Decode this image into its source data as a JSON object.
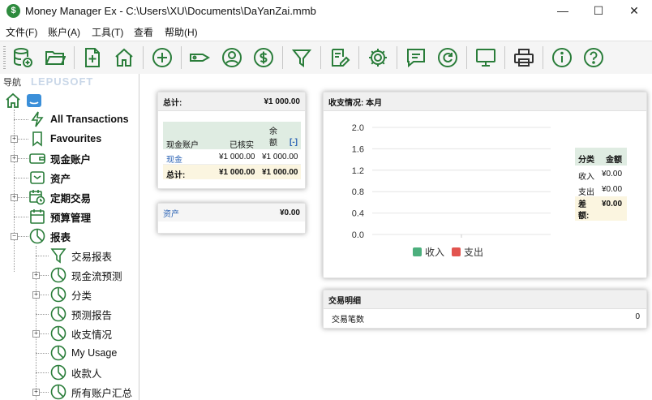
{
  "window": {
    "title": "Money Manager Ex - C:\\Users\\XU\\Documents\\DaYanZai.mmb",
    "app_icon_glyph": "$",
    "min_glyph": "—",
    "max_glyph": "☐",
    "close_glyph": "✕"
  },
  "menu": [
    "文件(F)",
    "账户(A)",
    "工具(T)",
    "查看",
    "帮助(H)"
  ],
  "toolbar": {
    "buttons": [
      "database-icon",
      "open-folder-icon",
      "new-file-icon",
      "home-icon",
      "add-transaction-icon",
      "tag-icon",
      "user-icon",
      "currency-icon",
      "filter-icon",
      "edit-icon",
      "settings-icon",
      "chat-icon",
      "refresh-icon",
      "monitor-icon",
      "print-icon",
      "info-icon",
      "help-icon"
    ],
    "accent_color": "#2a7d3a"
  },
  "nav": {
    "title": "导航",
    "watermark": "LEPUSOFT",
    "items": [
      {
        "label": "All Transactions",
        "bold": true
      },
      {
        "label": "Favourites",
        "bold": true
      },
      {
        "label": "现金账户",
        "bold": true
      },
      {
        "label": "资产",
        "bold": true
      },
      {
        "label": "定期交易",
        "bold": true
      },
      {
        "label": "预算管理",
        "bold": true
      },
      {
        "label": "报表",
        "bold": true
      },
      {
        "label": "交易报表",
        "bold": false
      },
      {
        "label": "现金流预测",
        "bold": false
      },
      {
        "label": "分类",
        "bold": false
      },
      {
        "label": "预测报告",
        "bold": false
      },
      {
        "label": "收支情况",
        "bold": false
      },
      {
        "label": "My Usage",
        "bold": false
      },
      {
        "label": "收款人",
        "bold": false
      },
      {
        "label": "所有账户汇总",
        "bold": false
      }
    ]
  },
  "summary": {
    "header_label": "总计:",
    "header_value": "¥1 000.00",
    "col_account": "现金账户",
    "col_reconciled": "已核实",
    "col_balance": "余额",
    "collapse": "[-]",
    "rows": [
      {
        "name": "现金",
        "reconciled": "¥1 000.00",
        "balance": "¥1 000.00"
      }
    ],
    "total_label": "总计:",
    "total_reconciled": "¥1 000.00",
    "total_balance": "¥1 000.00"
  },
  "assets": {
    "label": "资产",
    "value": "¥0.00"
  },
  "income_expense": {
    "header": "收支情况: 本月",
    "table_col1": "分类",
    "table_col2": "金额",
    "rows": [
      {
        "name": "收入",
        "value": "¥0.00"
      },
      {
        "name": "支出",
        "value": "¥0.00"
      }
    ],
    "diff_label": "差额:",
    "diff_value": "¥0.00",
    "legend": [
      {
        "name": "收入",
        "color": "#4caf7d"
      },
      {
        "name": "支出",
        "color": "#e2544f"
      }
    ]
  },
  "transactions": {
    "header": "交易明细",
    "row_label": "交易笔数",
    "row_value": "0"
  },
  "chart_data": {
    "type": "bar",
    "categories": [
      ""
    ],
    "series": [
      {
        "name": "收入",
        "values": [
          0
        ]
      },
      {
        "name": "支出",
        "values": [
          0
        ]
      }
    ],
    "yticks": [
      "2.0",
      "1.6",
      "1.2",
      "0.8",
      "0.4",
      "0.0"
    ],
    "ylim": [
      0,
      2.0
    ],
    "grid": true,
    "legend": "bottom"
  }
}
